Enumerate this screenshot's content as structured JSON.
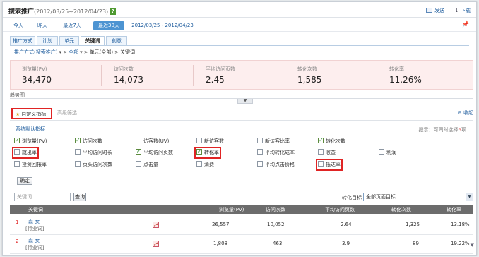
{
  "header": {
    "title": "搜索推广",
    "date_range": "(2012/03/25~2012/04/23)",
    "help": "?",
    "send": "发送",
    "download": "下载",
    "download_icon": "↓"
  },
  "date_tabs": [
    "今天",
    "昨天",
    "最近7天",
    "最近30天"
  ],
  "date_active": "最近30天",
  "custom_range": "2012/03/25 - 2012/04/23",
  "level_tabs": [
    "推广方式",
    "计划",
    "单元",
    "关键词",
    "创意"
  ],
  "level_active": "关键词",
  "breadcrumb": [
    "推广方式(搜索推广)",
    "全部",
    "单元(全部)",
    "关键词"
  ],
  "summary": [
    {
      "label": "浏览量(PV)",
      "value": "34,470"
    },
    {
      "label": "访问次数",
      "value": "14,073"
    },
    {
      "label": "平均访问页数",
      "value": "2.45"
    },
    {
      "label": "转化次数",
      "value": "1,585"
    },
    {
      "label": "转化率",
      "value": "11.26%"
    }
  ],
  "trend_label": "趋势图",
  "panel": {
    "custom_tab": "自定义指标",
    "adv_tab": "高级筛选",
    "collapse": "收起",
    "system_default": "系统默认指标",
    "tip_prefix": "提示：可同时选择",
    "tip_count": "6",
    "tip_suffix": "项",
    "confirm": "确定"
  },
  "indicators": [
    {
      "label": "浏览量(PV)",
      "checked": true
    },
    {
      "label": "访问次数",
      "checked": true
    },
    {
      "label": "访客数(UV)",
      "checked": false
    },
    {
      "label": "新访客数",
      "checked": false
    },
    {
      "label": "新访客比率",
      "checked": false
    },
    {
      "label": "转化次数",
      "checked": true
    },
    {
      "label": "跳出率",
      "checked": false
    },
    {
      "label": "平均访问时长",
      "checked": false
    },
    {
      "label": "平均访问页数",
      "checked": true
    },
    {
      "label": "转化率",
      "checked": true
    },
    {
      "label": "平均转化成本",
      "checked": false
    },
    {
      "label": "收益",
      "checked": false
    },
    {
      "label": "利润",
      "checked": false
    },
    {
      "label": "投资回报率",
      "checked": false
    },
    {
      "label": "页头访问次数",
      "checked": false
    },
    {
      "label": "点击量",
      "checked": false
    },
    {
      "label": "消费",
      "checked": false
    },
    {
      "label": "平均点击价格",
      "checked": false
    },
    {
      "label": "抵达率",
      "checked": false
    }
  ],
  "search": {
    "placeholder": "关键词",
    "button": "查询",
    "target_label": "转化目标",
    "target_value": "全部页面目标",
    "arrow": "▼"
  },
  "table": {
    "columns": [
      "关键词",
      "浏览量(PV)",
      "访问次数",
      "平均访问页数",
      "转化次数",
      "转化率"
    ],
    "rows": [
      {
        "index": "1",
        "keyword": "森 女",
        "type": "[行业词]",
        "pv": "26,557",
        "visits": "10,052",
        "avg_pages": "2.64",
        "conversions": "1,325",
        "rate": "13.18%"
      },
      {
        "index": "2",
        "keyword": "森 女",
        "type": "[行业词]",
        "pv": "1,808",
        "visits": "463",
        "avg_pages": "3.9",
        "conversions": "89",
        "rate": "19.22%"
      }
    ]
  },
  "colors": {
    "highlight": "#e02424",
    "link": "#1e5c9d",
    "active_tab": "#4d94d2",
    "summary_bg": "#fdeeee"
  }
}
